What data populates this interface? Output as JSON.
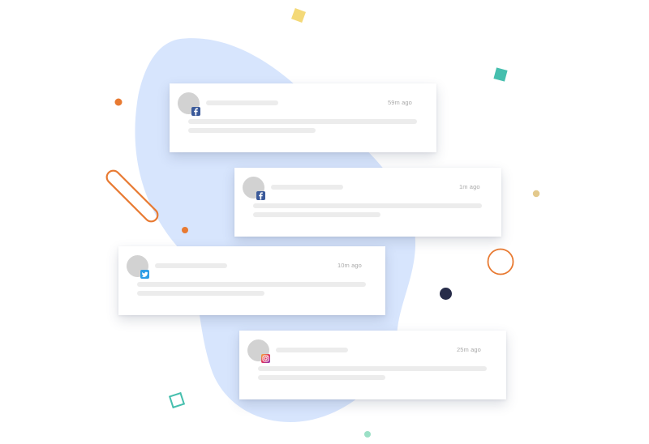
{
  "colors": {
    "blob": "#d7e5fd",
    "facebook": "#3b5a9a",
    "twitter": "#2d9de6",
    "instagram": "#c8317e",
    "skeleton": "#ececec",
    "avatar": "#d2d2d2",
    "orange": "#e87a32",
    "yellow": "#f4d978",
    "teal": "#46bfae",
    "navy": "#272c4a",
    "tan": "#e3c98c",
    "mint": "#9be0c6"
  },
  "notifications": [
    {
      "network": "facebook",
      "icon": "facebook-icon",
      "time": "59m ago"
    },
    {
      "network": "facebook",
      "icon": "facebook-icon",
      "time": "1m ago"
    },
    {
      "network": "twitter",
      "icon": "twitter-icon",
      "time": "10m ago"
    },
    {
      "network": "instagram",
      "icon": "instagram-icon",
      "time": "25m ago"
    }
  ]
}
